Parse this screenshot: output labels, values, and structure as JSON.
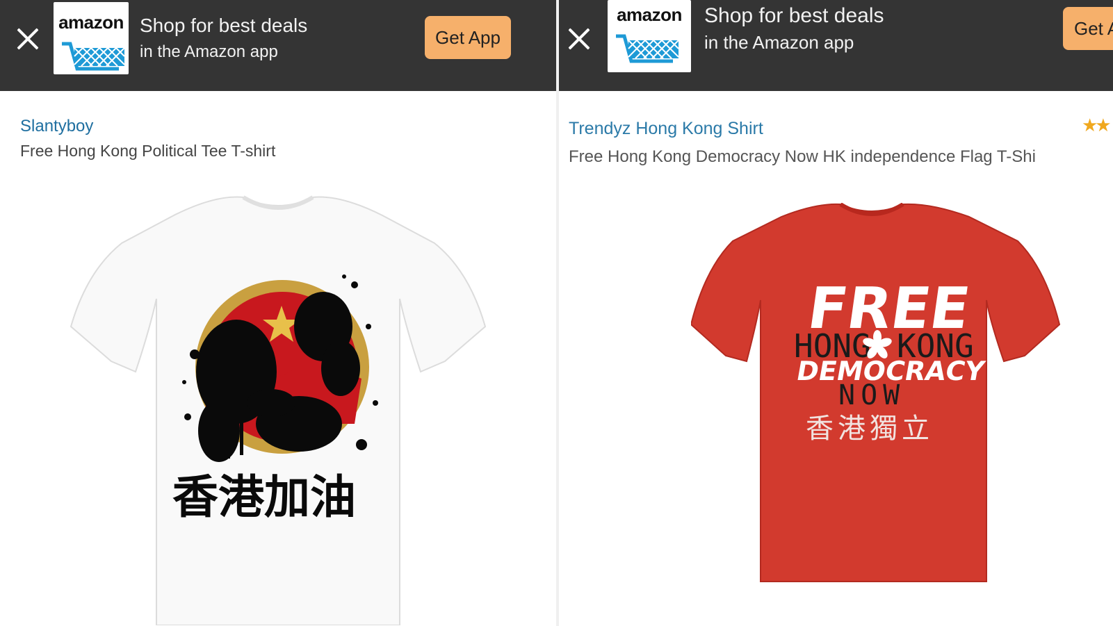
{
  "banner": {
    "logo_text": "amazon",
    "line1": "Shop for best deals",
    "line2": "in the Amazon app",
    "cta_label": "Get App",
    "cta_label_cropped": "Get A",
    "bg_color": "#343434",
    "cta_color": "#f6b06b"
  },
  "left_listing": {
    "seller": "Slantyboy",
    "title": "Free Hong Kong Political Tee T-shirt",
    "shirt_color": "white",
    "shirt_text": "香港加油"
  },
  "right_listing": {
    "seller": "Trendyz Hong Kong Shirt",
    "title": "Free Hong Kong Democracy Now HK independence Flag T-Shi",
    "rating_stars": "★★",
    "shirt_color": "red",
    "shirt_lines": [
      "FREE",
      "HONG",
      "KONG",
      "DEMOCRACY",
      "NOW",
      "香港獨立"
    ]
  }
}
